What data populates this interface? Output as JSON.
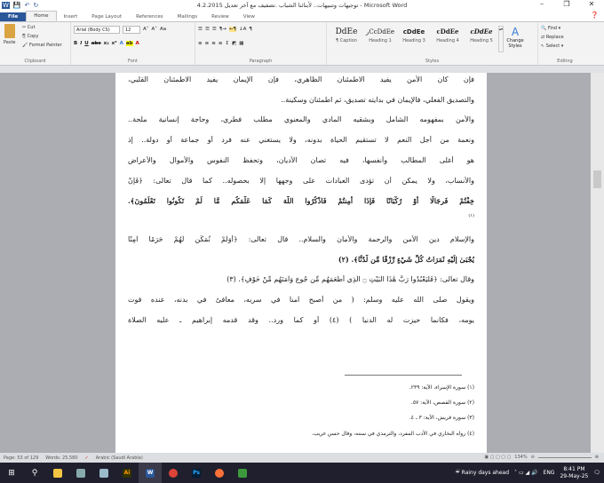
{
  "window": {
    "title": "4.2.2015 توجيهات وتنبيهات.. لأبنائنا الشباب .تصفيف مع آخر تعديل - Microsoft Word",
    "minimize": "–",
    "restore": "❐",
    "close": "✕"
  },
  "tabs": [
    "File",
    "Home",
    "Insert",
    "Page Layout",
    "References",
    "Mailings",
    "Review",
    "View"
  ],
  "clipboard": {
    "paste": "Paste",
    "cut": "Cut",
    "copy": "Copy",
    "format_painter": "Format Painter",
    "label": "Clipboard"
  },
  "font": {
    "name": "Arial (Body CS)",
    "size": "12",
    "label": "Font"
  },
  "paragraph": {
    "label": "Paragraph"
  },
  "styles": {
    "items": [
      {
        "sample": "DdEe",
        "name": "¶ Caption"
      },
      {
        "sample": "ﺭCcDdEe",
        "name": "Heading 1"
      },
      {
        "sample": "cDdEe",
        "name": "Heading 3"
      },
      {
        "sample": "cDdEe",
        "name": "Heading 4"
      },
      {
        "sample": "cDdEe",
        "name": "Heading 5"
      }
    ],
    "change": "Change Styles",
    "label": "Styles"
  },
  "editing": {
    "find": "Find",
    "replace": "Replace",
    "select": "Select",
    "label": "Editing"
  },
  "document": {
    "lines": [
      "فإن كان الأمن يفيد الاطمئنان الظاهري، فإن الإيمان يفيد الاطمئنان القلبي،",
      "والتصديق الفعلي، فالإيمان في بدايته تصديق، ثم اطمئنان وسكينة..",
      "والأمن بمفهومه الشامل وبشقيه المادي والمعنوي مطلب فطري، وحاجة إنسانية ملحة..",
      "ونعمة من أجل النعم لا تستقيم الحياة بدونه، ولا يستغني عنه فرد أو جماعة أو دولة.. إذ",
      "هو أغلى المطالب وأنفسها، فيه تصان الأديان، وتحفظ النفوس والأموال والأعراض",
      "والأنساب، ولا يمكن أن تؤدى العبادات على وجهها إلا بحصوله.. كما قال تعالى: ﴿فَإِنْ",
      "خِفْتُمْ فَرِجَالًا أَوْ رُكْبَانًا فَإِذَا أَمِنتُمْ فَاذْكُرُوا اللَّهَ كَمَا عَلَّمَكُم مَّا لَمْ تَكُونُوا تَعْلَمُونَ﴾.",
      "(١)",
      "والإسلام دين الأمن والرحمة والأمان والسلام.. قال تعالى: ﴿أَوَلَمْ نُمَكِّن لَّهُمْ حَرَمًا آمِنًا",
      "يُجْبَىٰ إِلَيْهِ ثَمَرَاتُ كُلِّ شَيْءٍ رِّزْقًا مِّن لَّدُنَّا﴾. (٢)",
      "وقال تعالى: ﴿فَلْيَعْبُدُوا رَبَّ هَٰذَا الْبَيْتِ ۝ الَّذِي أَطْعَمَهُم مِّن جُوعٍ وَآمَنَهُم مِّنْ خَوْفٍ﴾. (٣)",
      "ويقول صلى الله عليه وسلم: ( من أصبح آمناً في سربه، معافىً في بدنه، عنده قوت",
      "يومه، فكأنما حيزت له الدنيا ) (٤) أو كما ورد.. وقد قدمه إبراهيم ـ عليه الصلاة"
    ],
    "footnotes": [
      "(١) سورة الإسراء، الآية: ٢٣٩.",
      "(٢) سورة القصص، الآية: ٥٧.",
      "(٣) سورة قريش، الآية: ٣ ـ ٤.",
      "(٤) رواه البخاري في الأدب المفرد، والترمذي في سننه، وقال حسن غريب."
    ]
  },
  "status": {
    "page": "Page: 53 of 129",
    "words": "Words: 25,580",
    "language": "Arabic (Saudi Arabia)",
    "zoom": "134%"
  },
  "taskbar": {
    "weather": "Rainy days ahead",
    "lang": "ENG",
    "time": "8:41 PM",
    "date": "29-May-25"
  }
}
